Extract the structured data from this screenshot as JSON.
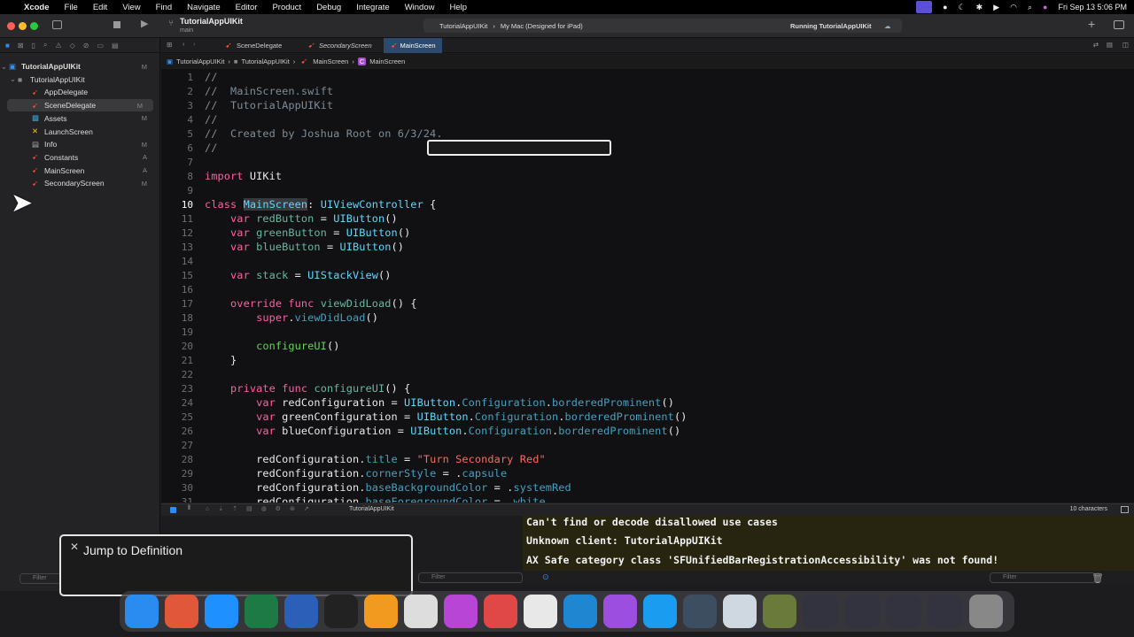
{
  "menubar": {
    "app": "Xcode",
    "items": [
      "File",
      "Edit",
      "View",
      "Find",
      "Navigate",
      "Editor",
      "Product",
      "Debug",
      "Integrate",
      "Window",
      "Help"
    ],
    "clock": "Fri Sep 13  5:06 PM"
  },
  "toolbar": {
    "project": "TutorialAppUIKit",
    "branch": "main",
    "scheme": "TutorialAppUIKit",
    "destination": "My Mac (Designed for iPad)",
    "status": "Running TutorialAppUIKit"
  },
  "navigator": {
    "items": [
      {
        "label": "TutorialAppUIKit",
        "badge": "M",
        "icon": "project-icon",
        "level": 0
      },
      {
        "label": "TutorialAppUIKit",
        "badge": "",
        "icon": "folder-icon",
        "level": 1
      },
      {
        "label": "AppDelegate",
        "badge": "",
        "icon": "swift-file-icon",
        "level": 2
      },
      {
        "label": "SceneDelegate",
        "badge": "M",
        "icon": "swift-file-icon",
        "level": 2
      },
      {
        "label": "Assets",
        "badge": "M",
        "icon": "assets-icon",
        "level": 2
      },
      {
        "label": "LaunchScreen",
        "badge": "",
        "icon": "storyboard-icon",
        "level": 2
      },
      {
        "label": "Info",
        "badge": "M",
        "icon": "plist-icon",
        "level": 2
      },
      {
        "label": "Constants",
        "badge": "A",
        "icon": "swift-file-icon",
        "level": 2
      },
      {
        "label": "MainScreen",
        "badge": "A",
        "icon": "swift-file-icon",
        "level": 2
      },
      {
        "label": "SecondaryScreen",
        "badge": "M",
        "icon": "swift-file-icon",
        "level": 2
      }
    ],
    "selected": "SceneDelegate",
    "filter_placeholder": "Filter"
  },
  "tabs": [
    {
      "label": "SceneDelegate",
      "active": false
    },
    {
      "label": "SecondaryScreen",
      "active": false
    },
    {
      "label": "MainScreen",
      "active": true
    }
  ],
  "breadcrumb": [
    "TutorialAppUIKit",
    "TutorialAppUIKit",
    "MainScreen",
    "MainScreen"
  ],
  "editor": {
    "current_line": 10,
    "lines": [
      [
        [
          "c",
          "//"
        ]
      ],
      [
        [
          "c",
          "//  MainScreen.swift"
        ]
      ],
      [
        [
          "c",
          "//  TutorialAppUIKit"
        ]
      ],
      [
        [
          "c",
          "//"
        ]
      ],
      [
        [
          "c",
          "//  Created by Joshua Root on 6/3/24."
        ]
      ],
      [
        [
          "c",
          "//"
        ]
      ],
      [],
      [
        [
          "k",
          "import"
        ],
        [
          "p",
          " UIKit"
        ]
      ],
      [],
      [
        [
          "k",
          "class"
        ],
        [
          "p",
          " "
        ],
        [
          "h",
          "MainScreen"
        ],
        [
          "p",
          ": "
        ],
        [
          "t",
          "UIViewController"
        ],
        [
          "p",
          " {"
        ]
      ],
      [
        [
          "p",
          "    "
        ],
        [
          "k",
          "var"
        ],
        [
          "p",
          " "
        ],
        [
          "d",
          "redButton"
        ],
        [
          "p",
          " = "
        ],
        [
          "t",
          "UIButton"
        ],
        [
          "p",
          "()"
        ]
      ],
      [
        [
          "p",
          "    "
        ],
        [
          "k",
          "var"
        ],
        [
          "p",
          " "
        ],
        [
          "d",
          "greenButton"
        ],
        [
          "p",
          " = "
        ],
        [
          "t",
          "UIButton"
        ],
        [
          "p",
          "()"
        ]
      ],
      [
        [
          "p",
          "    "
        ],
        [
          "k",
          "var"
        ],
        [
          "p",
          " "
        ],
        [
          "d",
          "blueButton"
        ],
        [
          "p",
          " = "
        ],
        [
          "t",
          "UIButton"
        ],
        [
          "p",
          "()"
        ]
      ],
      [],
      [
        [
          "p",
          "    "
        ],
        [
          "k",
          "var"
        ],
        [
          "p",
          " "
        ],
        [
          "d",
          "stack"
        ],
        [
          "p",
          " = "
        ],
        [
          "t",
          "UIStackView"
        ],
        [
          "p",
          "()"
        ]
      ],
      [],
      [
        [
          "p",
          "    "
        ],
        [
          "k",
          "override"
        ],
        [
          "p",
          " "
        ],
        [
          "k",
          "func"
        ],
        [
          "p",
          " "
        ],
        [
          "d",
          "viewDidLoad"
        ],
        [
          "p",
          "() {"
        ]
      ],
      [
        [
          "p",
          "        "
        ],
        [
          "k",
          "super"
        ],
        [
          "p",
          "."
        ],
        [
          "m",
          "viewDidLoad"
        ],
        [
          "p",
          "()"
        ]
      ],
      [],
      [
        [
          "p",
          "        "
        ],
        [
          "u",
          "configureUI"
        ],
        [
          "p",
          "()"
        ]
      ],
      [
        [
          "p",
          "    }"
        ]
      ],
      [],
      [
        [
          "p",
          "    "
        ],
        [
          "k",
          "private"
        ],
        [
          "p",
          " "
        ],
        [
          "k",
          "func"
        ],
        [
          "p",
          " "
        ],
        [
          "d",
          "configureUI"
        ],
        [
          "p",
          "() {"
        ]
      ],
      [
        [
          "p",
          "        "
        ],
        [
          "k",
          "var"
        ],
        [
          "p",
          " redConfiguration = "
        ],
        [
          "t",
          "UIButton"
        ],
        [
          "p",
          "."
        ],
        [
          "m",
          "Configuration"
        ],
        [
          "p",
          "."
        ],
        [
          "m",
          "borderedProminent"
        ],
        [
          "p",
          "()"
        ]
      ],
      [
        [
          "p",
          "        "
        ],
        [
          "k",
          "var"
        ],
        [
          "p",
          " greenConfiguration = "
        ],
        [
          "t",
          "UIButton"
        ],
        [
          "p",
          "."
        ],
        [
          "m",
          "Configuration"
        ],
        [
          "p",
          "."
        ],
        [
          "m",
          "borderedProminent"
        ],
        [
          "p",
          "()"
        ]
      ],
      [
        [
          "p",
          "        "
        ],
        [
          "k",
          "var"
        ],
        [
          "p",
          " blueConfiguration = "
        ],
        [
          "t",
          "UIButton"
        ],
        [
          "p",
          "."
        ],
        [
          "m",
          "Configuration"
        ],
        [
          "p",
          "."
        ],
        [
          "m",
          "borderedProminent"
        ],
        [
          "p",
          "()"
        ]
      ],
      [],
      [
        [
          "p",
          "        redConfiguration."
        ],
        [
          "m",
          "title"
        ],
        [
          "p",
          " = "
        ],
        [
          "s",
          "\"Turn Secondary Red\""
        ]
      ],
      [
        [
          "p",
          "        redConfiguration."
        ],
        [
          "m",
          "cornerStyle"
        ],
        [
          "p",
          " = ."
        ],
        [
          "m",
          "capsule"
        ]
      ],
      [
        [
          "p",
          "        redConfiguration."
        ],
        [
          "m",
          "baseBackgroundColor"
        ],
        [
          "p",
          " = ."
        ],
        [
          "m",
          "systemRed"
        ]
      ],
      [
        [
          "p",
          "        redConfiguration."
        ],
        [
          "m",
          "baseForegroundColor"
        ],
        [
          "p",
          " = ."
        ],
        [
          "m",
          "white"
        ]
      ]
    ]
  },
  "debugbar": {
    "process": "TutorialAppUIKit",
    "char_count": "10 characters"
  },
  "console": {
    "lines": [
      "Can't find or decode disallowed use cases",
      "Unknown client: TutorialAppUIKit",
      "AX Safe category class 'SFUnifiedBarRegistrationAccessibility' was not found!"
    ],
    "filter_placeholder": "Filter"
  },
  "variables": {
    "filter_placeholder": "Filter"
  },
  "popup": {
    "title": "Jump to Definition"
  },
  "dock": {
    "apps": [
      {
        "name": "finder",
        "color": "#2a8cf0"
      },
      {
        "name": "launchpad",
        "color": "#e0573a"
      },
      {
        "name": "safari",
        "color": "#1e90ff"
      },
      {
        "name": "excel",
        "color": "#1d7a45"
      },
      {
        "name": "word",
        "color": "#2b5fb8"
      },
      {
        "name": "terminal",
        "color": "#222222"
      },
      {
        "name": "app-orange",
        "color": "#f29a1f"
      },
      {
        "name": "chrome",
        "color": "#dddddd"
      },
      {
        "name": "feedback",
        "color": "#b845d6"
      },
      {
        "name": "app-red",
        "color": "#e04848"
      },
      {
        "name": "textedit",
        "color": "#e8e8e8"
      },
      {
        "name": "vscode",
        "color": "#1f86d1"
      },
      {
        "name": "podcasts",
        "color": "#9b4ee0"
      },
      {
        "name": "xcode",
        "color": "#1a9cf0"
      },
      {
        "name": "quicktime",
        "color": "#3d4e60"
      },
      {
        "name": "preview",
        "color": "#cfd8e0"
      },
      {
        "name": "yoda-photo",
        "color": "#6a7a3a"
      },
      {
        "name": "window-1",
        "color": "#333340"
      },
      {
        "name": "window-2",
        "color": "#333340"
      },
      {
        "name": "window-3",
        "color": "#333340"
      },
      {
        "name": "window-4",
        "color": "#333340"
      },
      {
        "name": "trash",
        "color": "#888888"
      }
    ]
  }
}
